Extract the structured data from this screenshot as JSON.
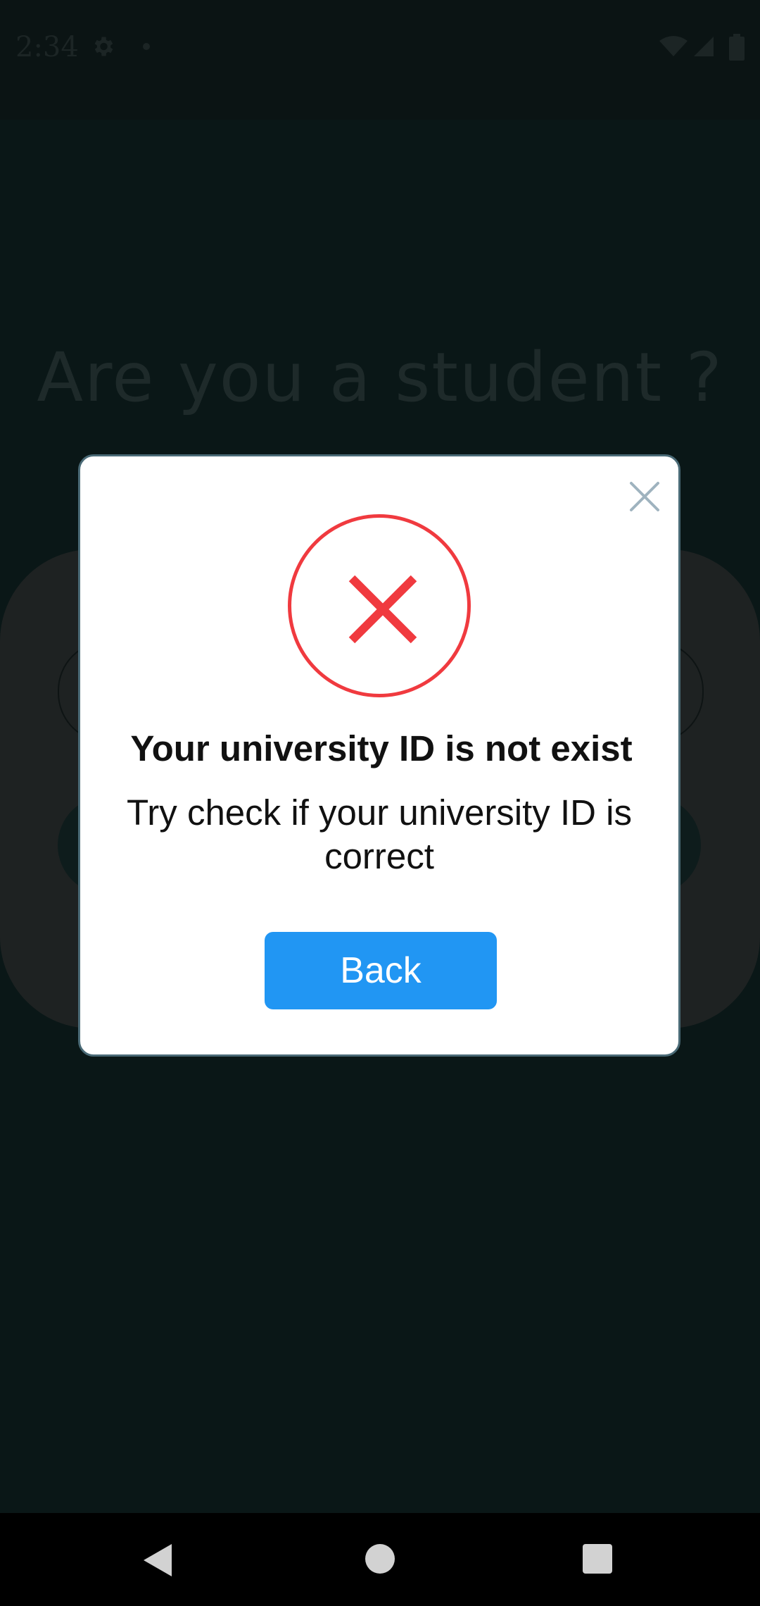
{
  "status_bar": {
    "time": "2:34",
    "settings_icon": "gear-icon",
    "notification_dot": "dot-icon",
    "wifi_icon": "wifi-icon",
    "signal_icon": "signal-icon",
    "battery_icon": "battery-icon"
  },
  "background": {
    "heading": "Are you a student ?"
  },
  "dialog": {
    "close_icon": "close-icon",
    "status_icon": "error-x-icon",
    "title": "Your university ID is not exist",
    "message": "Try check if your university ID is correct",
    "back_label": "Back",
    "colors": {
      "error": "#f03a3f",
      "button": "#2196f3"
    }
  },
  "nav_bar": {
    "back_icon": "triangle-back-icon",
    "home_icon": "circle-home-icon",
    "recents_icon": "square-recents-icon"
  }
}
